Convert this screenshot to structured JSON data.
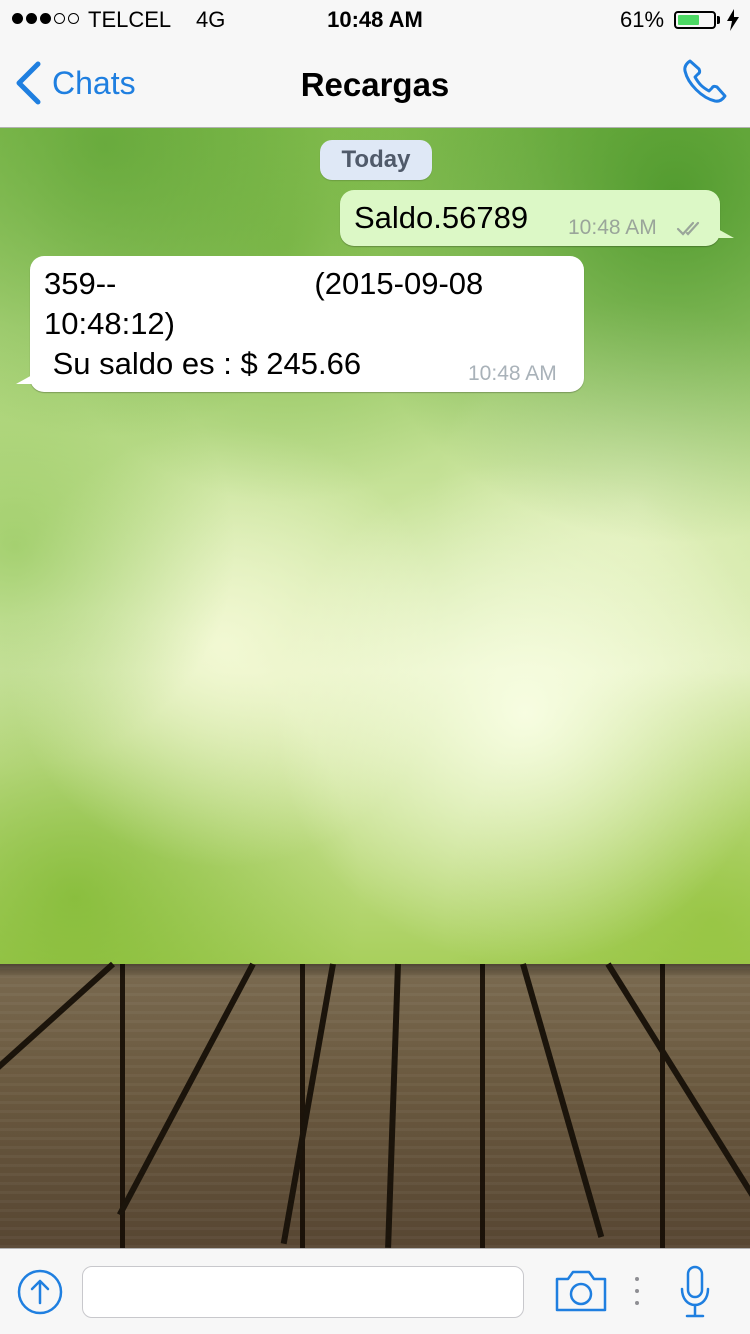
{
  "status_bar": {
    "carrier": "TELCEL",
    "network": "4G",
    "time": "10:48 AM",
    "battery_percent": "61%",
    "battery_level": 0.61,
    "signal_bars_filled": 3,
    "signal_bars_total": 5
  },
  "nav": {
    "back_label": "Chats",
    "title": "Recargas",
    "back_icon": "chevron-left-icon",
    "call_icon": "phone-icon"
  },
  "chat": {
    "date_label": "Today",
    "messages": [
      {
        "direction": "outgoing",
        "text": "Saldo.56789",
        "time": "10:48 AM",
        "status": "read"
      },
      {
        "direction": "incoming",
        "line1_prefix": "359--",
        "line1_suffix": "(2015-09-08",
        "line2": "10:48:12)",
        "line3": " Su saldo es : $ 245.66",
        "time": "10:48 AM"
      }
    ]
  },
  "input_bar": {
    "message_value": "",
    "attach_icon": "share-icon",
    "camera_icon": "camera-icon",
    "more_icon": "more-vertical-icon",
    "mic_icon": "microphone-icon"
  },
  "colors": {
    "accent": "#1f7fe0",
    "outgoing_bubble": "#dcf8c6",
    "incoming_bubble": "#ffffff",
    "battery": "#4cd964"
  }
}
